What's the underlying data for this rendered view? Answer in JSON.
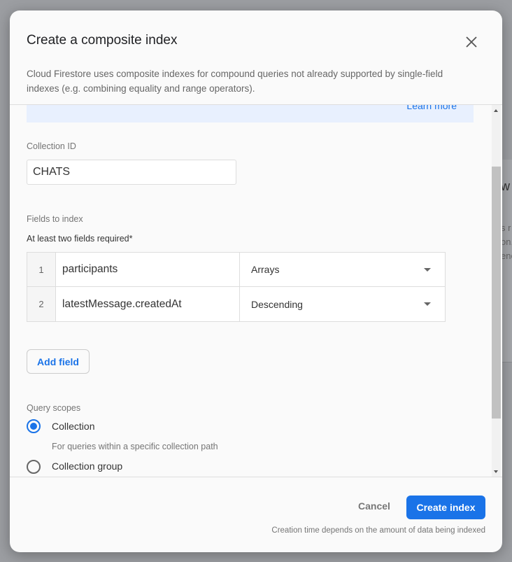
{
  "background": {
    "fragments": [
      "w",
      "s r",
      "on.",
      "ene"
    ]
  },
  "dialog": {
    "title": "Create a composite index",
    "description": "Cloud Firestore uses composite indexes for compound queries not already supported by single-field indexes (e.g. combining equality and range operators).",
    "learn_more": "Learn more",
    "collection_label": "Collection ID",
    "collection_value": "CHATS",
    "fields_label": "Fields to index",
    "fields_hint": "At least two fields required*",
    "fields": [
      {
        "num": "1",
        "path": "participants",
        "mode": "Arrays"
      },
      {
        "num": "2",
        "path": "latestMessage.createdAt",
        "mode": "Descending"
      }
    ],
    "add_field": "Add field",
    "scopes_label": "Query scopes",
    "scopes": [
      {
        "label": "Collection",
        "hint": "For queries within a specific collection path",
        "selected": true
      },
      {
        "label": "Collection group",
        "selected": false
      }
    ],
    "cancel": "Cancel",
    "create": "Create index",
    "note": "Creation time depends on the amount of data being indexed",
    "accent": "#1a73e8"
  }
}
